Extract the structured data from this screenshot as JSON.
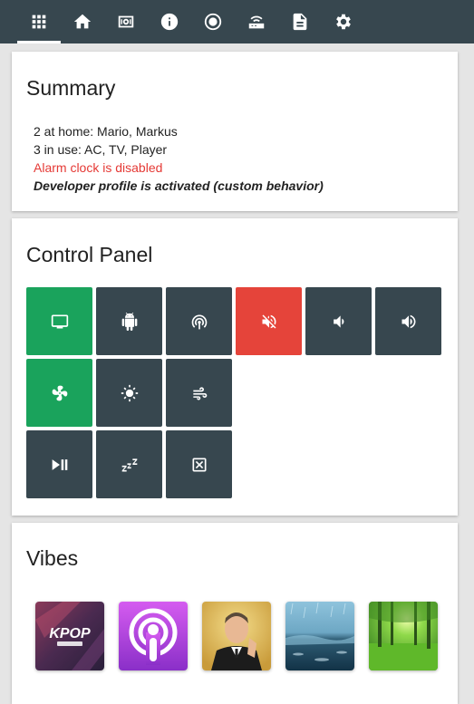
{
  "nav": {
    "items": [
      {
        "icon": "grid-icon",
        "active": true
      },
      {
        "icon": "home-icon",
        "active": false
      },
      {
        "icon": "speaker-icon",
        "active": false
      },
      {
        "icon": "info-icon",
        "active": false
      },
      {
        "icon": "radio-button-icon",
        "active": false
      },
      {
        "icon": "router-icon",
        "active": false
      },
      {
        "icon": "document-icon",
        "active": false
      },
      {
        "icon": "gear-icon",
        "active": false
      }
    ],
    "background": "#37474f"
  },
  "summary": {
    "title": "Summary",
    "at_home": "2 at home: Mario, Markus",
    "in_use": "3 in use: AC, TV, Player",
    "alarm": "Alarm clock is disabled",
    "developer": "Developer profile is activated (custom behavior)"
  },
  "control_panel": {
    "title": "Control Panel",
    "tiles": [
      {
        "icon": "tv-icon",
        "state": "on"
      },
      {
        "icon": "android-icon",
        "state": "off"
      },
      {
        "icon": "cast-icon",
        "state": "off"
      },
      {
        "icon": "mute-icon",
        "state": "alert"
      },
      {
        "icon": "volume-down-icon",
        "state": "off"
      },
      {
        "icon": "volume-up-icon",
        "state": "off"
      },
      {
        "icon": "fan-icon",
        "state": "on"
      },
      {
        "icon": "brightness-icon",
        "state": "off"
      },
      {
        "icon": "wind-icon",
        "state": "off"
      },
      {
        "icon": "play-pause-icon",
        "state": "off"
      },
      {
        "icon": "sleep-icon",
        "state": "off"
      },
      {
        "icon": "close-box-icon",
        "state": "off"
      }
    ],
    "colors": {
      "on": "#1aa35c",
      "off": "#37474f",
      "alert": "#e5443a"
    }
  },
  "vibes": {
    "title": "Vibes",
    "items": [
      {
        "name": "kpop-album-art",
        "logo_text": "KPOP"
      },
      {
        "name": "podcasts-app-art"
      },
      {
        "name": "entertainer-art"
      },
      {
        "name": "rain-water-art"
      },
      {
        "name": "forest-art"
      }
    ]
  }
}
